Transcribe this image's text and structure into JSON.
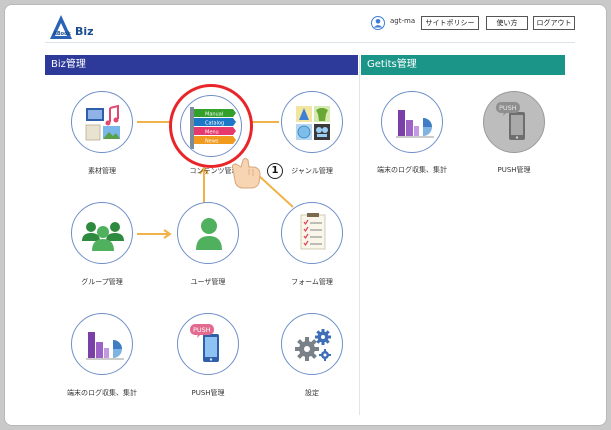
{
  "header": {
    "logo_small": "ABook",
    "logo_main": "Biz",
    "username": "agt-ma",
    "buttons": [
      "サイトポリシー",
      "使い方",
      "ログアウト"
    ]
  },
  "sections": {
    "biz_title": "Biz管理",
    "getits_title": "Getits管理"
  },
  "biz_items": [
    {
      "label": "素材管理"
    },
    {
      "label": "コンテンツ管理"
    },
    {
      "label": "ジャンル管理"
    },
    {
      "label": "グループ管理"
    },
    {
      "label": "ユーザ管理"
    },
    {
      "label": "フォーム管理"
    },
    {
      "label": "端末のログ収集、集計"
    },
    {
      "label": "PUSH管理"
    },
    {
      "label": "設定"
    }
  ],
  "getits_items": [
    {
      "label": "端末のログ収集、集計"
    },
    {
      "label": "PUSH管理"
    }
  ],
  "contents_tags": [
    "Manual",
    "Catalog",
    "Menu",
    "News"
  ],
  "push_badge": "PUSH",
  "annotation_number": "1",
  "colors": {
    "biz_header": "#2e3a99",
    "getits_header": "#1b9588",
    "highlight_ring": "#e8262a",
    "connector": "#f0b34a",
    "circle_border": "#6f8fc9"
  }
}
